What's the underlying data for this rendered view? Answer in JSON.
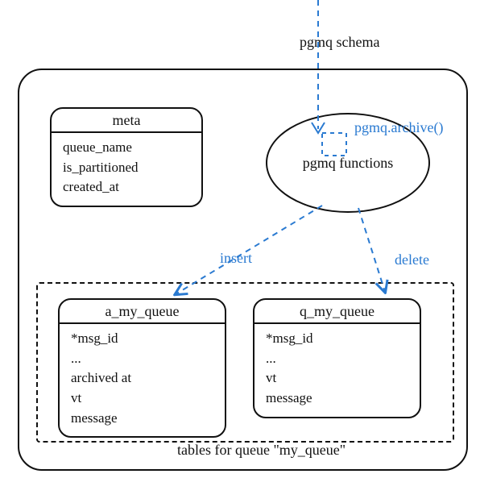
{
  "schema_label": "pgmq schema",
  "function_call_label": "pgmq.archive()",
  "functions_ellipse_label": "pgmq functions",
  "arrow_labels": {
    "insert": "insert",
    "delete": "delete"
  },
  "tables_group_caption": "tables for queue \"my_queue\"",
  "tables": {
    "meta": {
      "title": "meta",
      "fields": [
        "queue_name",
        "is_partitioned",
        "created_at"
      ]
    },
    "a_my_queue": {
      "title": "a_my_queue",
      "fields": [
        "*msg_id",
        "...",
        "archived at",
        "vt",
        "message"
      ]
    },
    "q_my_queue": {
      "title": "q_my_queue",
      "fields": [
        "*msg_id",
        "...",
        "vt",
        "message"
      ]
    }
  }
}
